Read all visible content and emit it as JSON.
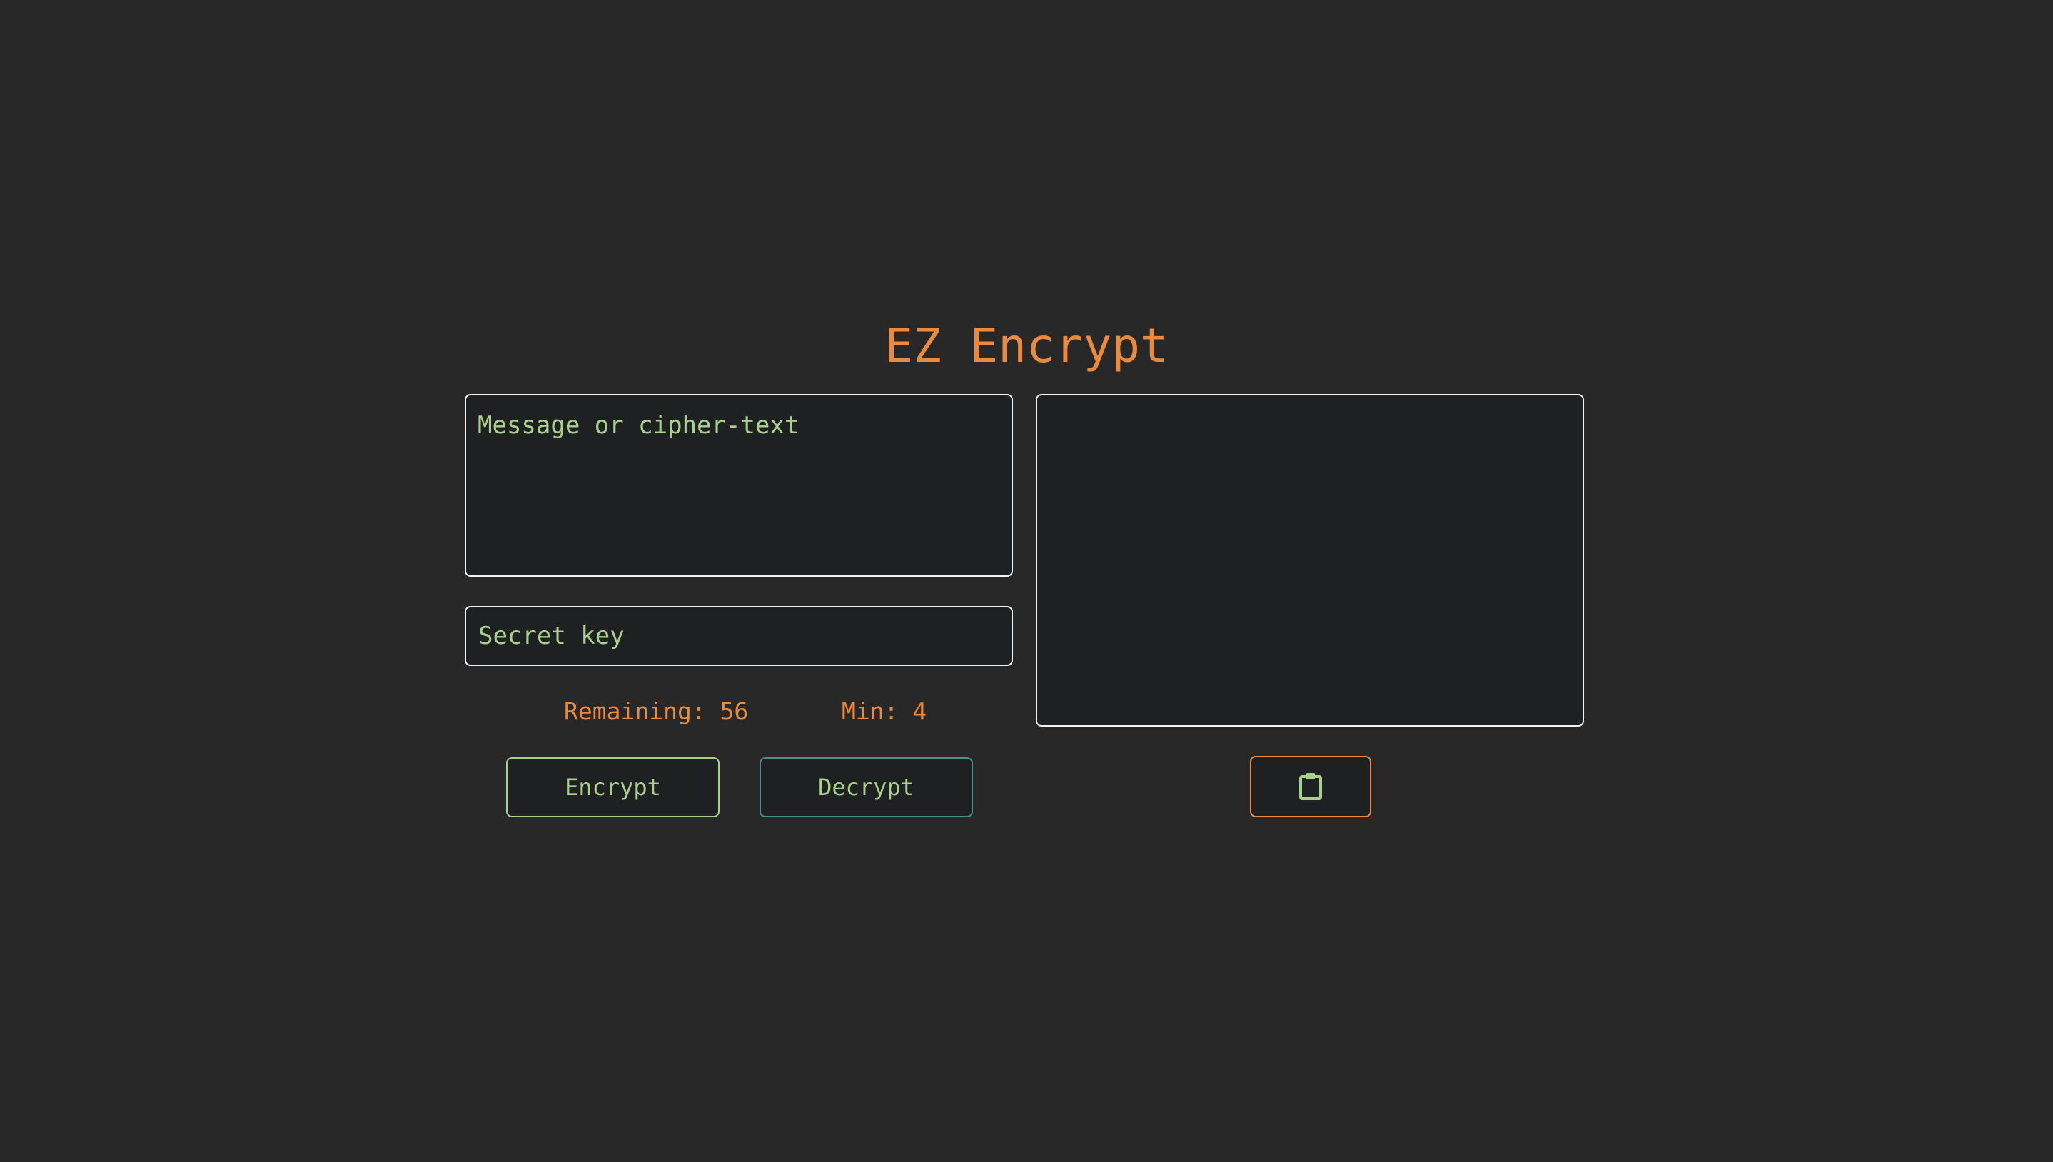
{
  "app": {
    "title": "EZ Encrypt"
  },
  "inputs": {
    "message_placeholder": "Message or cipher-text",
    "message_value": "",
    "secret_placeholder": "Secret key",
    "secret_value": "",
    "output_value": ""
  },
  "stats": {
    "remaining_label": "Remaining: 56",
    "min_label": "Min: 4",
    "remaining": 56,
    "min": 4
  },
  "buttons": {
    "encrypt_label": "Encrypt",
    "decrypt_label": "Decrypt",
    "copy_icon": "clipboard-icon"
  },
  "colors": {
    "background": "#282828",
    "panel": "#1f2022",
    "accent_orange": "#ea8a3f",
    "text_green": "#a9d18e",
    "border_white": "#f2f2f2",
    "decrypt_border": "#4f8f8a"
  }
}
